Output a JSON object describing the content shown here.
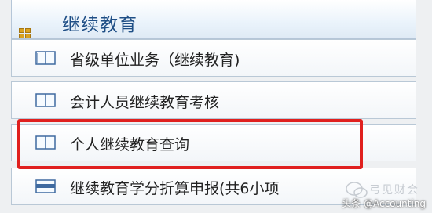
{
  "section": {
    "title": "继续教育"
  },
  "menu": {
    "items": [
      {
        "label": "省级单位业务（继续教育)",
        "icon": "book-icon"
      },
      {
        "label": "会计人员继续教育考核",
        "icon": "book-icon"
      },
      {
        "label": "个人继续教育查询",
        "icon": "book-icon",
        "highlighted": true
      },
      {
        "label": "继续教育学分折算申报(共6小项",
        "icon": "list-icon"
      }
    ]
  },
  "watermark": {
    "text": "头条 @Accounting",
    "brand": "弓见财会"
  },
  "colors": {
    "highlight": "#e0201e",
    "title": "#1f4f86"
  }
}
